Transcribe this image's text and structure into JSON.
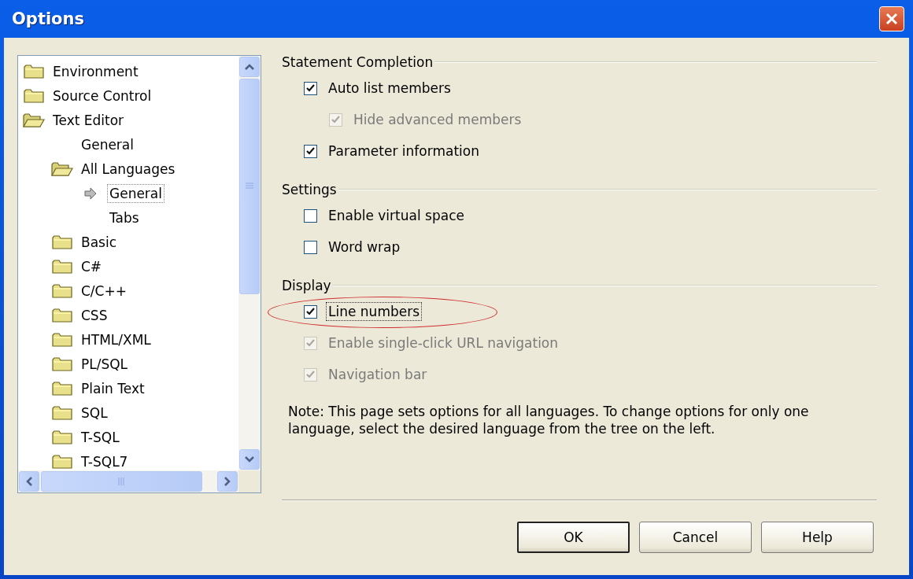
{
  "window": {
    "title": "Options"
  },
  "tree": [
    {
      "label": "Environment",
      "kind": "folder",
      "expanded": false,
      "selected": false
    },
    {
      "label": "Source Control",
      "kind": "folder",
      "expanded": false,
      "selected": false
    },
    {
      "label": "Text Editor",
      "kind": "folder",
      "expanded": true,
      "selected": false,
      "children": [
        {
          "label": "General",
          "kind": "page",
          "selected": false
        },
        {
          "label": "All Languages",
          "kind": "folder",
          "expanded": true,
          "selected": false,
          "children": [
            {
              "label": "General",
              "kind": "page",
              "selected": true
            },
            {
              "label": "Tabs",
              "kind": "page",
              "selected": false
            }
          ]
        },
        {
          "label": "Basic",
          "kind": "folder",
          "expanded": false,
          "selected": false
        },
        {
          "label": "C#",
          "kind": "folder",
          "expanded": false,
          "selected": false
        },
        {
          "label": "C/C++",
          "kind": "folder",
          "expanded": false,
          "selected": false
        },
        {
          "label": "CSS",
          "kind": "folder",
          "expanded": false,
          "selected": false
        },
        {
          "label": "HTML/XML",
          "kind": "folder",
          "expanded": false,
          "selected": false
        },
        {
          "label": "PL/SQL",
          "kind": "folder",
          "expanded": false,
          "selected": false
        },
        {
          "label": "Plain Text",
          "kind": "folder",
          "expanded": false,
          "selected": false
        },
        {
          "label": "SQL",
          "kind": "folder",
          "expanded": false,
          "selected": false
        },
        {
          "label": "T-SQL",
          "kind": "folder",
          "expanded": false,
          "selected": false
        },
        {
          "label": "T-SQL7",
          "kind": "folder",
          "expanded": false,
          "selected": false
        }
      ]
    }
  ],
  "groups": [
    {
      "title": "Statement Completion",
      "options": [
        {
          "label": "Auto list members",
          "checked": true,
          "disabled": false,
          "indented": false,
          "focused": false
        },
        {
          "label": "Hide advanced members",
          "checked": true,
          "disabled": true,
          "indented": true,
          "focused": false
        },
        {
          "label": "Parameter information",
          "checked": true,
          "disabled": false,
          "indented": false,
          "focused": false
        }
      ]
    },
    {
      "title": "Settings",
      "options": [
        {
          "label": "Enable virtual space",
          "checked": false,
          "disabled": false,
          "indented": false,
          "focused": false
        },
        {
          "label": "Word wrap",
          "checked": false,
          "disabled": false,
          "indented": false,
          "focused": false
        }
      ]
    },
    {
      "title": "Display",
      "options": [
        {
          "label": "Line numbers",
          "checked": true,
          "disabled": false,
          "indented": false,
          "focused": true,
          "circled": true
        },
        {
          "label": "Enable single-click URL navigation",
          "checked": true,
          "disabled": true,
          "indented": false,
          "focused": false
        },
        {
          "label": "Navigation bar",
          "checked": true,
          "disabled": true,
          "indented": false,
          "focused": false
        }
      ]
    }
  ],
  "note": "Note: This page sets options for all languages. To change options for only one language, select the desired language from the tree on the left.",
  "buttons": [
    {
      "label": "OK",
      "default": true
    },
    {
      "label": "Cancel",
      "default": false
    },
    {
      "label": "Help",
      "default": false
    }
  ]
}
